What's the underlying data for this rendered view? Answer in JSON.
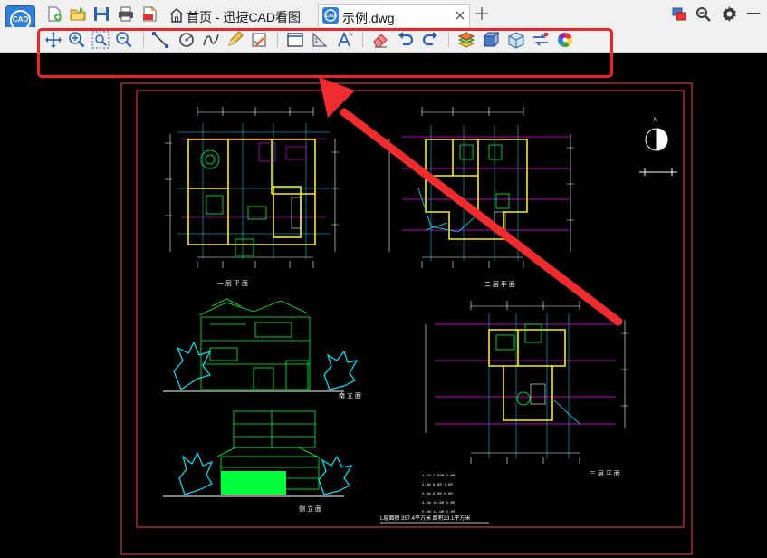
{
  "app": {
    "logo_text": "CAD"
  },
  "tabs": [
    {
      "label": "首页 - 迅捷CAD看图"
    },
    {
      "label": "示例.dwg"
    }
  ],
  "drawing": {
    "plan1_caption": "一 层 平 面",
    "plan2_caption": "二 层 平 面",
    "plan3_caption": "三 层 平 面",
    "elev1_caption": "南 立 面",
    "elev2_caption": "侧 立 面",
    "footer_text": "L层面积 357.4平方米 面积23.1平方米"
  },
  "colors": {
    "highlight": "#e8262a",
    "border_red": "#ff3333",
    "cad_green": "#00ff3a",
    "cad_cyan": "#00e5ff",
    "cad_magenta": "#ff00ff",
    "cad_yellow": "#ffee00"
  }
}
